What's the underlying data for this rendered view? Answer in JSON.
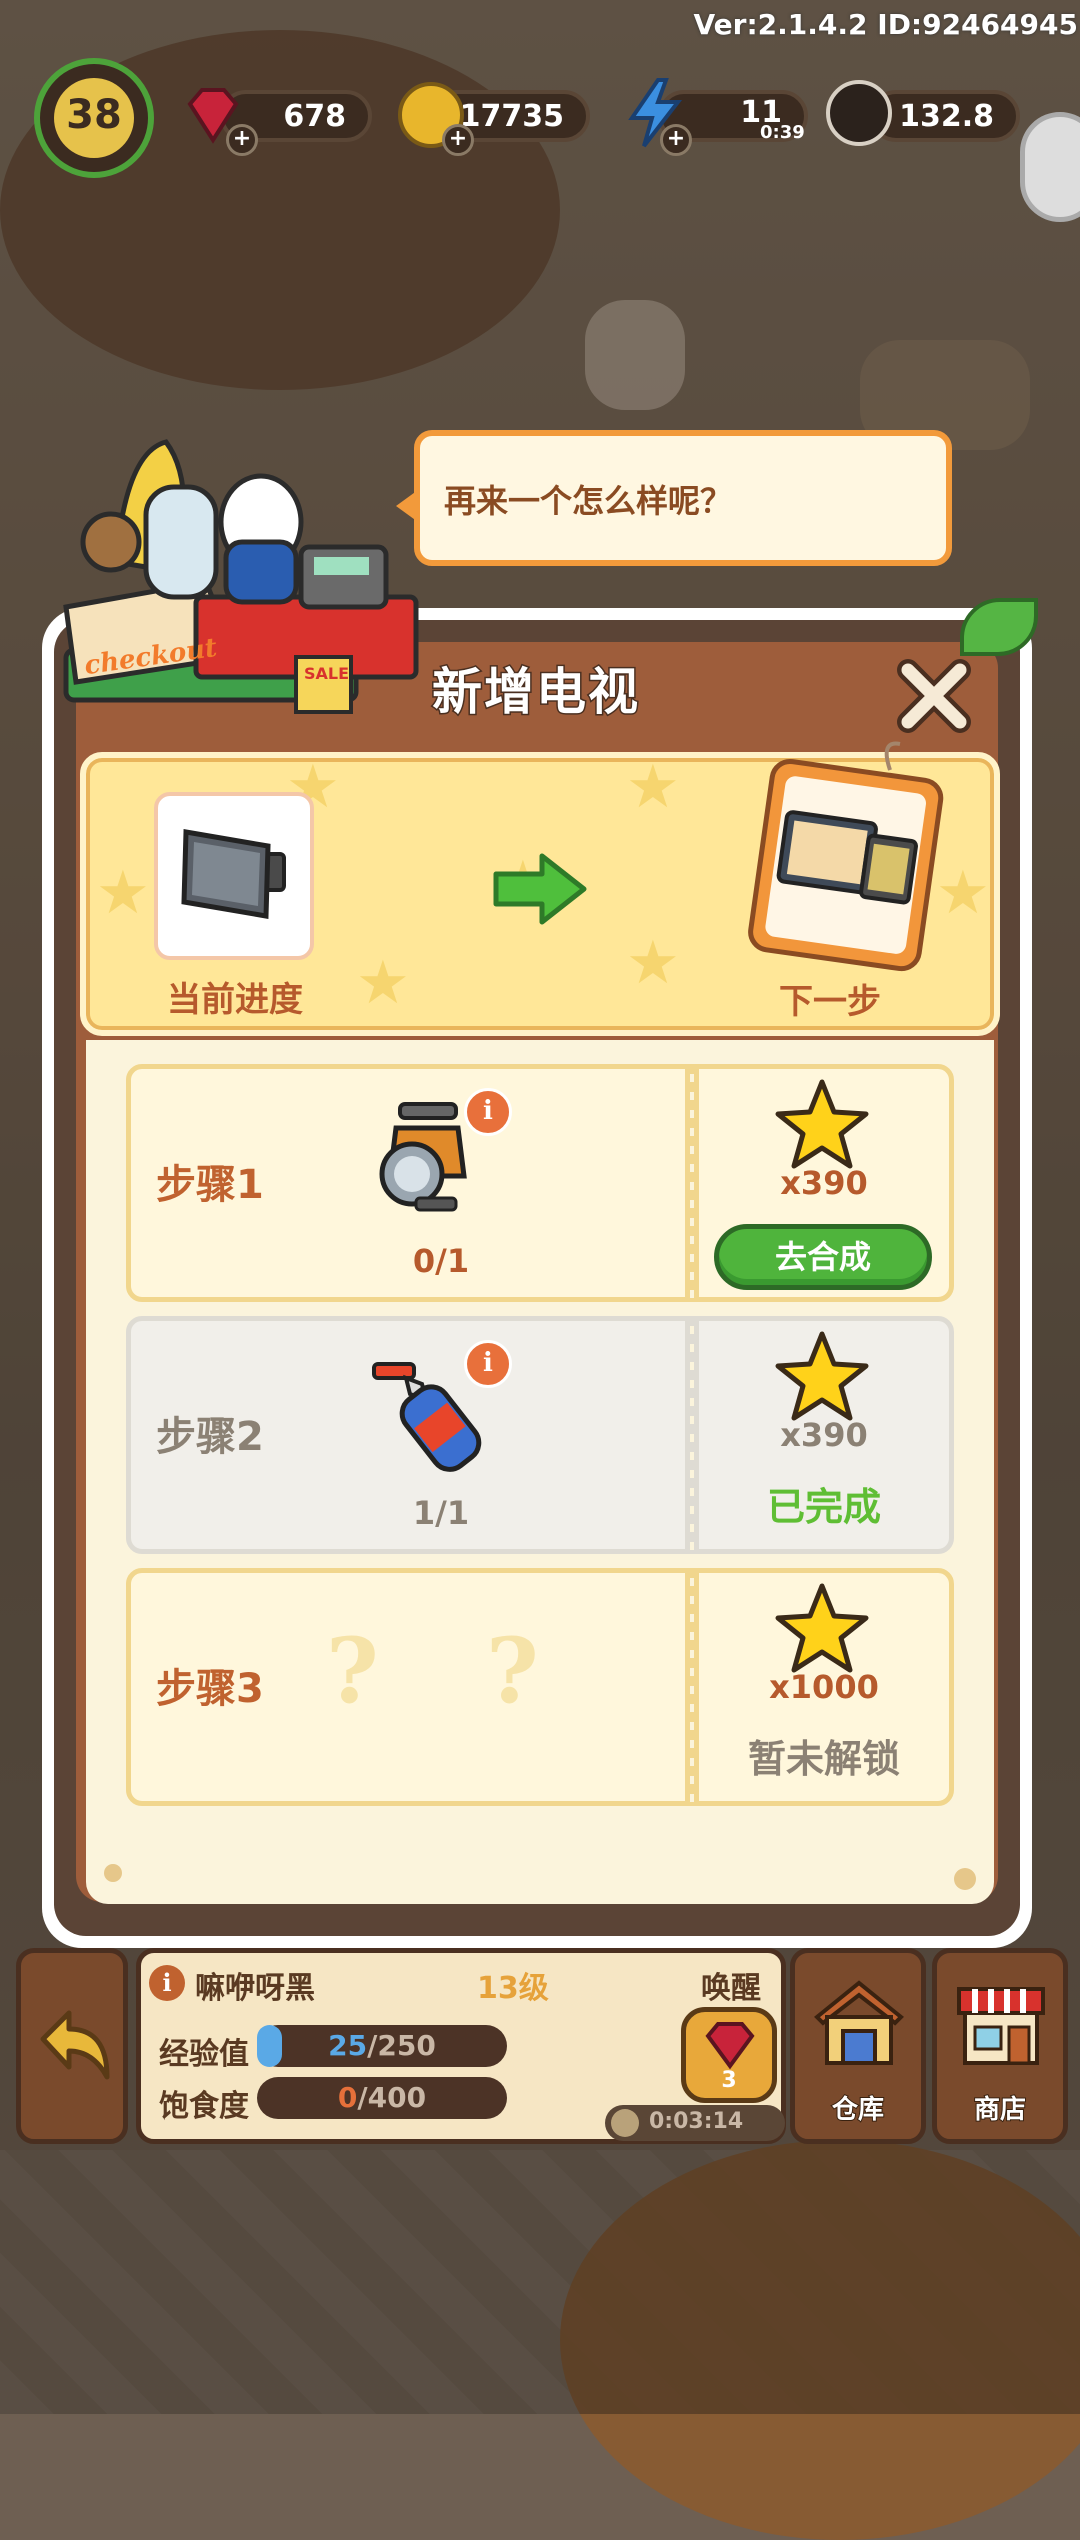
{
  "hud": {
    "version": "Ver:2.1.4.2 ID:92464945",
    "level": "38",
    "gems": "678",
    "coins": "17735",
    "energy": "11",
    "energy_timer": "0:39",
    "seeds": "132.8"
  },
  "speech": {
    "text": "再来一个怎么样呢？"
  },
  "shop_sign": {
    "checkout": "checkout",
    "sale": "SALE"
  },
  "dialog": {
    "title": "新增电视",
    "current_progress_label": "当前进度",
    "next_step_label": "下一步",
    "steps": [
      {
        "label": "步骤1",
        "count": "0/1",
        "reward": "x390",
        "action": "去合成",
        "state": "active"
      },
      {
        "label": "步骤2",
        "count": "1/1",
        "reward": "x390",
        "action": "已完成",
        "state": "done"
      },
      {
        "label": "步骤3",
        "count": "",
        "reward": "x1000",
        "action": "暂未解锁",
        "state": "locked",
        "unknown": [
          "?",
          "?"
        ]
      }
    ]
  },
  "bottom": {
    "pet_name": "嘛咿呀黑",
    "pet_level": "13级",
    "wake_label": "唤醒",
    "wake_cost": "3",
    "exp_label": "经验值",
    "exp_value": "25",
    "exp_max": "/250",
    "exp_fraction": 0.1,
    "food_label": "饱食度",
    "food_value": "0",
    "food_max": "/400",
    "food_fraction": 0,
    "timer": "0:03:14",
    "warehouse_label": "仓库",
    "shop_label": "商店"
  },
  "colors": {
    "dialog_border": "#5b4436",
    "dialog_body": "#9e5d3b",
    "progress_bg": "#ffe798",
    "step_label_active": "#c0622f",
    "step_label_done": "#8b8174",
    "synth_green": "#4fb43c",
    "done_green": "#5fbe34",
    "star": "#ffd21a"
  },
  "icons": [
    "tv-icon",
    "arrow-right-icon",
    "tv-card-icon",
    "spotlight-icon",
    "spray-bottle-icon",
    "star-icon",
    "close-icon",
    "info-icon",
    "back-arrow-icon",
    "warehouse-icon",
    "shop-icon",
    "gem-icon",
    "coin-icon",
    "energy-icon",
    "seed-icon"
  ]
}
